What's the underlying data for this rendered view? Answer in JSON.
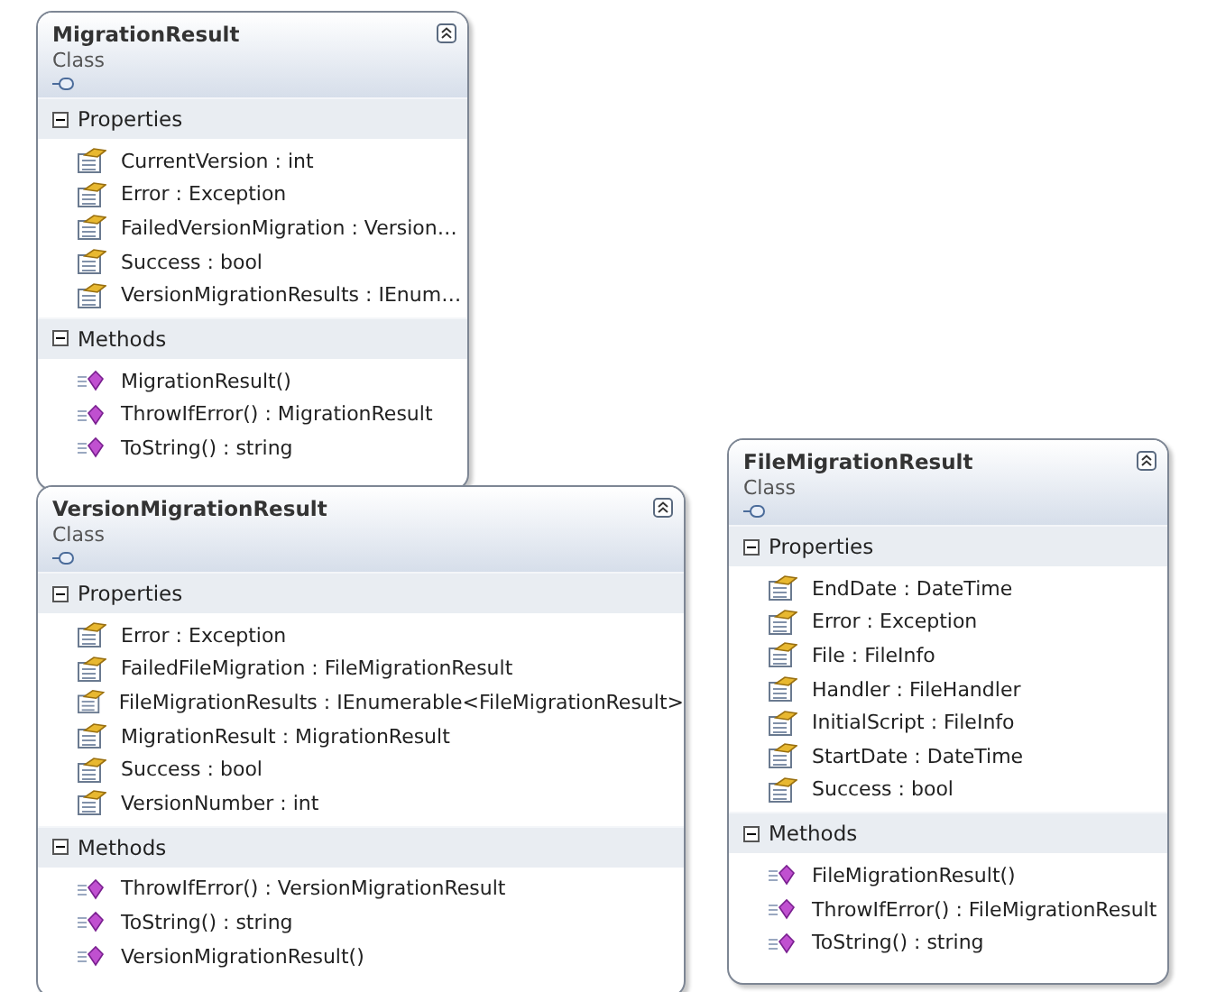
{
  "classes": [
    {
      "name": "MigrationResult",
      "stereotype": "Class",
      "sections": [
        {
          "title": "Properties",
          "kind": "properties",
          "expanded": true,
          "members": [
            "CurrentVersion : int",
            "Error : Exception",
            "FailedVersionMigration  :  Version…",
            "Success : bool",
            "VersionMigrationResults  :  IEnum…"
          ]
        },
        {
          "title": "Methods",
          "kind": "methods",
          "expanded": true,
          "members": [
            "MigrationResult()",
            "ThrowIfError() : MigrationResult",
            "ToString() : string"
          ]
        }
      ]
    },
    {
      "name": "VersionMigrationResult",
      "stereotype": "Class",
      "sections": [
        {
          "title": "Properties",
          "kind": "properties",
          "expanded": true,
          "members": [
            "Error : Exception",
            "FailedFileMigration : FileMigrationResult",
            "FileMigrationResults : IEnumerable<FileMigrationResult>",
            "MigrationResult : MigrationResult",
            "Success : bool",
            "VersionNumber : int"
          ]
        },
        {
          "title": "Methods",
          "kind": "methods",
          "expanded": true,
          "members": [
            "ThrowIfError() : VersionMigrationResult",
            "ToString() : string",
            "VersionMigrationResult()"
          ]
        }
      ]
    },
    {
      "name": "FileMigrationResult",
      "stereotype": "Class",
      "sections": [
        {
          "title": "Properties",
          "kind": "properties",
          "expanded": true,
          "members": [
            "EndDate : DateTime",
            "Error : Exception",
            "File : FileInfo",
            "Handler : FileHandler",
            "InitialScript : FileInfo",
            "StartDate : DateTime",
            "Success : bool"
          ]
        },
        {
          "title": "Methods",
          "kind": "methods",
          "expanded": true,
          "members": [
            "FileMigrationResult()",
            "ThrowIfError() : FileMigrationResult",
            "ToString() : string"
          ]
        }
      ]
    }
  ]
}
